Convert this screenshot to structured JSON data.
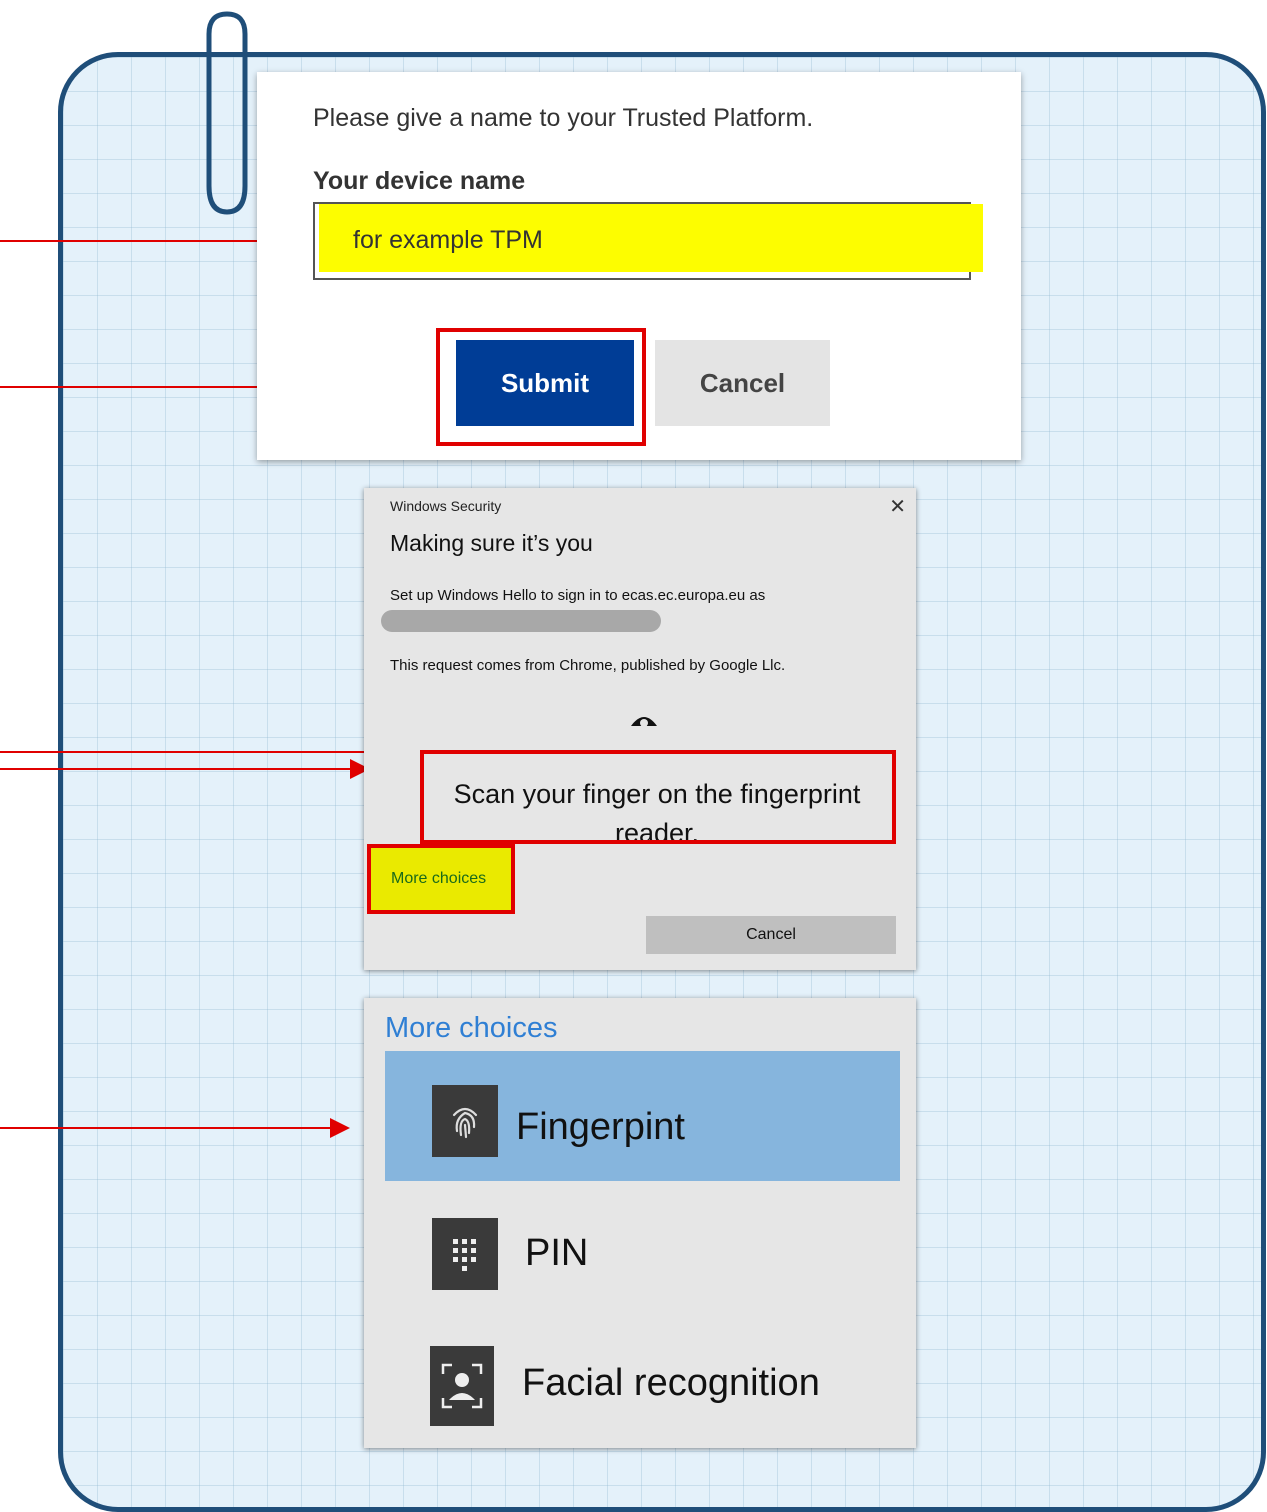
{
  "device_dialog": {
    "prompt": "Please give a name to your Trusted Platform.",
    "field_label": "Your device name",
    "field_value": "for example  TPM",
    "submit_label": "Submit",
    "cancel_label": "Cancel"
  },
  "security_dialog": {
    "title": "Windows Security",
    "close_glyph": "✕",
    "heading": "Making sure it’s you",
    "setup_text": "Set up Windows Hello to sign in to ecas.ec.europa.eu as",
    "request_text": "This request comes from Chrome, published by Google Llc.",
    "scan_text": "Scan your finger on the fingerprint reader.",
    "more_choices_label": "More choices",
    "cancel_label": "Cancel"
  },
  "choices_panel": {
    "title": "More choices",
    "options": [
      {
        "label": "Fingerpint",
        "icon": "fingerprint-icon"
      },
      {
        "label": "PIN",
        "icon": "pin-keypad-icon"
      },
      {
        "label": "Facial recognition",
        "icon": "face-recognition-icon"
      }
    ]
  },
  "colors": {
    "frame_border": "#1f4e79",
    "highlight_red": "#e00000",
    "highlight_yellow": "#fdfd00",
    "submit_blue": "#003d96",
    "selected_option": "#86b5dd",
    "link_blue": "#2f7fd4"
  }
}
